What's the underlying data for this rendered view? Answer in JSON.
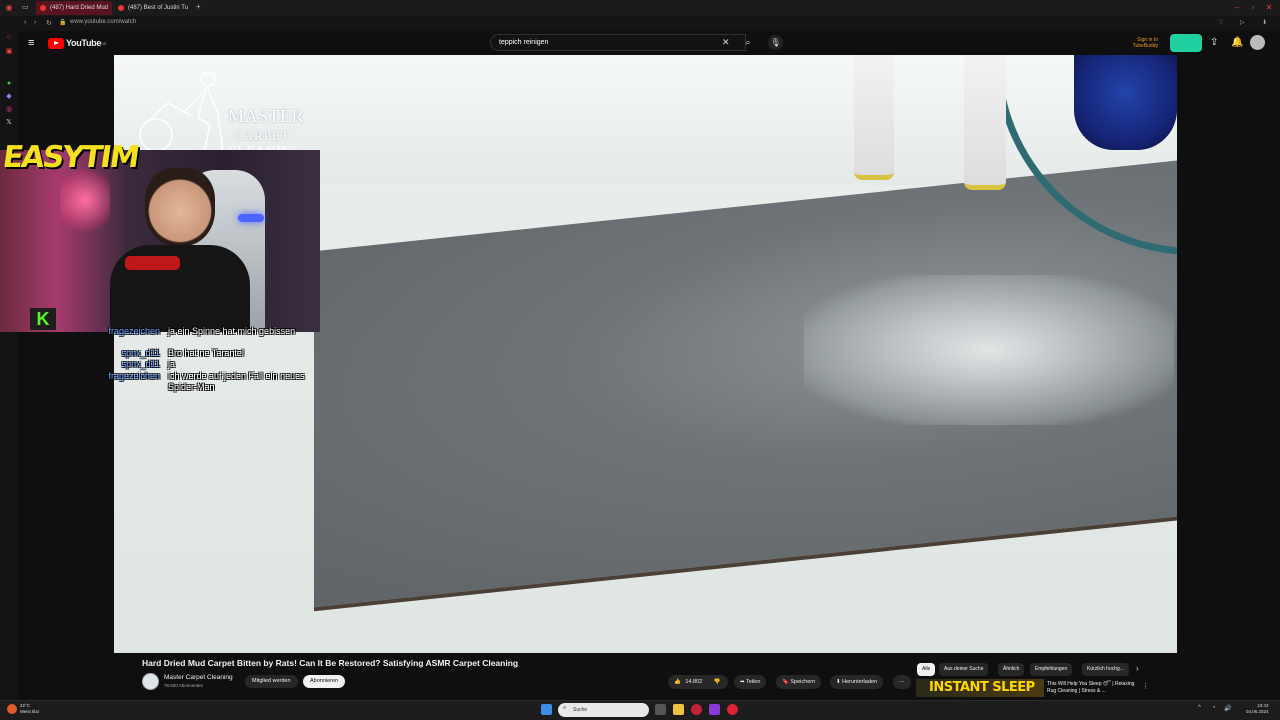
{
  "browser": {
    "tabs": [
      {
        "title": "(487) Hard Dried Mud"
      },
      {
        "title": "(487) Best of Justin Tu"
      }
    ],
    "url": "www.youtube.com/watch"
  },
  "youtube": {
    "logo_text": "YouTube",
    "logo_region": "DE",
    "search_value": "teppich reinigen",
    "sign_in": "Sign in to TubeBuddy"
  },
  "video": {
    "brand_line1": "MASTER",
    "brand_line2": "CARPET",
    "brand_line3": "CLEANING",
    "title": "Hard Dried Mud Carpet Bitten by Rats! Can It Be Restored? Satisfying ASMR Carpet Cleaning",
    "channel": "Master Carpet Cleaning",
    "subscribers": "76.500 Abonnenten",
    "join_label": "Mitglied werden",
    "subscribe_label": "Abonnieren",
    "likes": "14.802",
    "share_label": "Teilen",
    "save_label": "Speichern",
    "download_label": "Herunterladen"
  },
  "overlay": {
    "streamer": "EASYTIM",
    "chat": [
      {
        "user": "fragezeichen",
        "msg": "ja ein Spinne hat mich gebissen"
      },
      {
        "user": "spnx_d11",
        "msg": "Bro hat ne Tarantel"
      },
      {
        "user": "spnx_d11",
        "msg": "ja"
      },
      {
        "user": "fragezeichen",
        "msg": "ich werde auf jeden Fall ein neues Spider-Man"
      }
    ]
  },
  "recommendations": {
    "chips": [
      "Alle",
      "Aus deiner Suche",
      "Ähnlich",
      "Empfehlungen",
      "Kürzlich hochg..."
    ],
    "first": {
      "thumb_text": "INSTANT SLEEP",
      "title": "This Will Help You Sleep 😴 | Relaxing Rug Cleaning | Stress & ..."
    }
  },
  "taskbar": {
    "temp": "22°C",
    "weather": "Meist klar",
    "search_placeholder": "Suche",
    "time": "23:43",
    "date": "04.06.2024"
  },
  "colors": {
    "yt_red": "#ff0000",
    "kick_green": "#53fc18",
    "streamer_yellow": "#f5e11e",
    "chat_user": "#6aa0ff"
  }
}
